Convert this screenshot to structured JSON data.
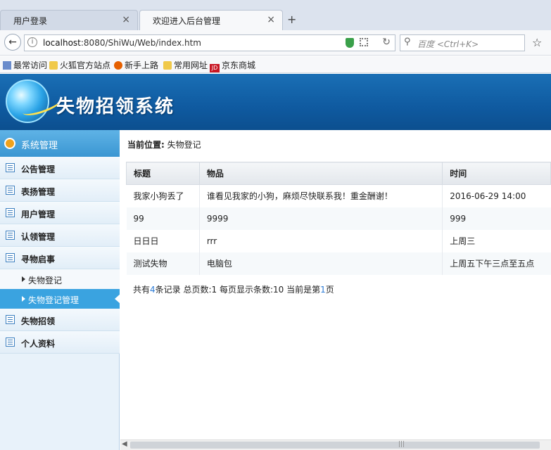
{
  "browser": {
    "tabs": [
      {
        "label": "用户登录"
      },
      {
        "label": "欢迎进入后台管理"
      }
    ],
    "new_tab": "+",
    "close": "×",
    "url_host": "localhost",
    "url_rest": ":8080/ShiWu/Web/index.htm",
    "search_placeholder": "百度 <Ctrl+K>",
    "bookmarks": [
      "最常访问",
      "火狐官方站点",
      "新手上路",
      "常用网址",
      "京东商城"
    ],
    "jd_icon_text": "JD"
  },
  "app": {
    "title": "失物招领系统"
  },
  "sidebar": {
    "system": "系统管理",
    "items": [
      {
        "label": "公告管理"
      },
      {
        "label": "表扬管理"
      },
      {
        "label": "用户管理"
      },
      {
        "label": "认领管理"
      },
      {
        "label": "寻物启事"
      }
    ],
    "subitems": [
      {
        "label": "失物登记"
      },
      {
        "label": "失物登记管理"
      }
    ],
    "items_after": [
      {
        "label": "失物招领"
      },
      {
        "label": "个人资料"
      }
    ]
  },
  "main": {
    "breadcrumb_label": "当前位置:",
    "breadcrumb_value": "失物登记",
    "table": {
      "headers": [
        "标题",
        "物品",
        "时间"
      ],
      "rows": [
        [
          "我家小狗丢了",
          "谁看见我家的小狗，麻烦尽快联系我！重金酬谢！",
          "2016-06-29 14:00"
        ],
        [
          "99",
          "9999",
          "999"
        ],
        [
          "日日日",
          "rrr",
          "上周三"
        ],
        [
          "测试失物",
          "电脑包",
          "上周五下午三点至五点"
        ]
      ]
    },
    "pager": {
      "p1": "共有",
      "total": "4",
      "p2": "条记录 总页数:",
      "pages": "1",
      "p3": " 每页显示条数:",
      "per_page": "10",
      "p4": " 当前是第",
      "current": "1",
      "p5": "页"
    }
  },
  "colors": {
    "header_blue": "#0f5aa0",
    "sidebar_active": "#3aa3e0",
    "link_blue": "#2b7bd6"
  }
}
